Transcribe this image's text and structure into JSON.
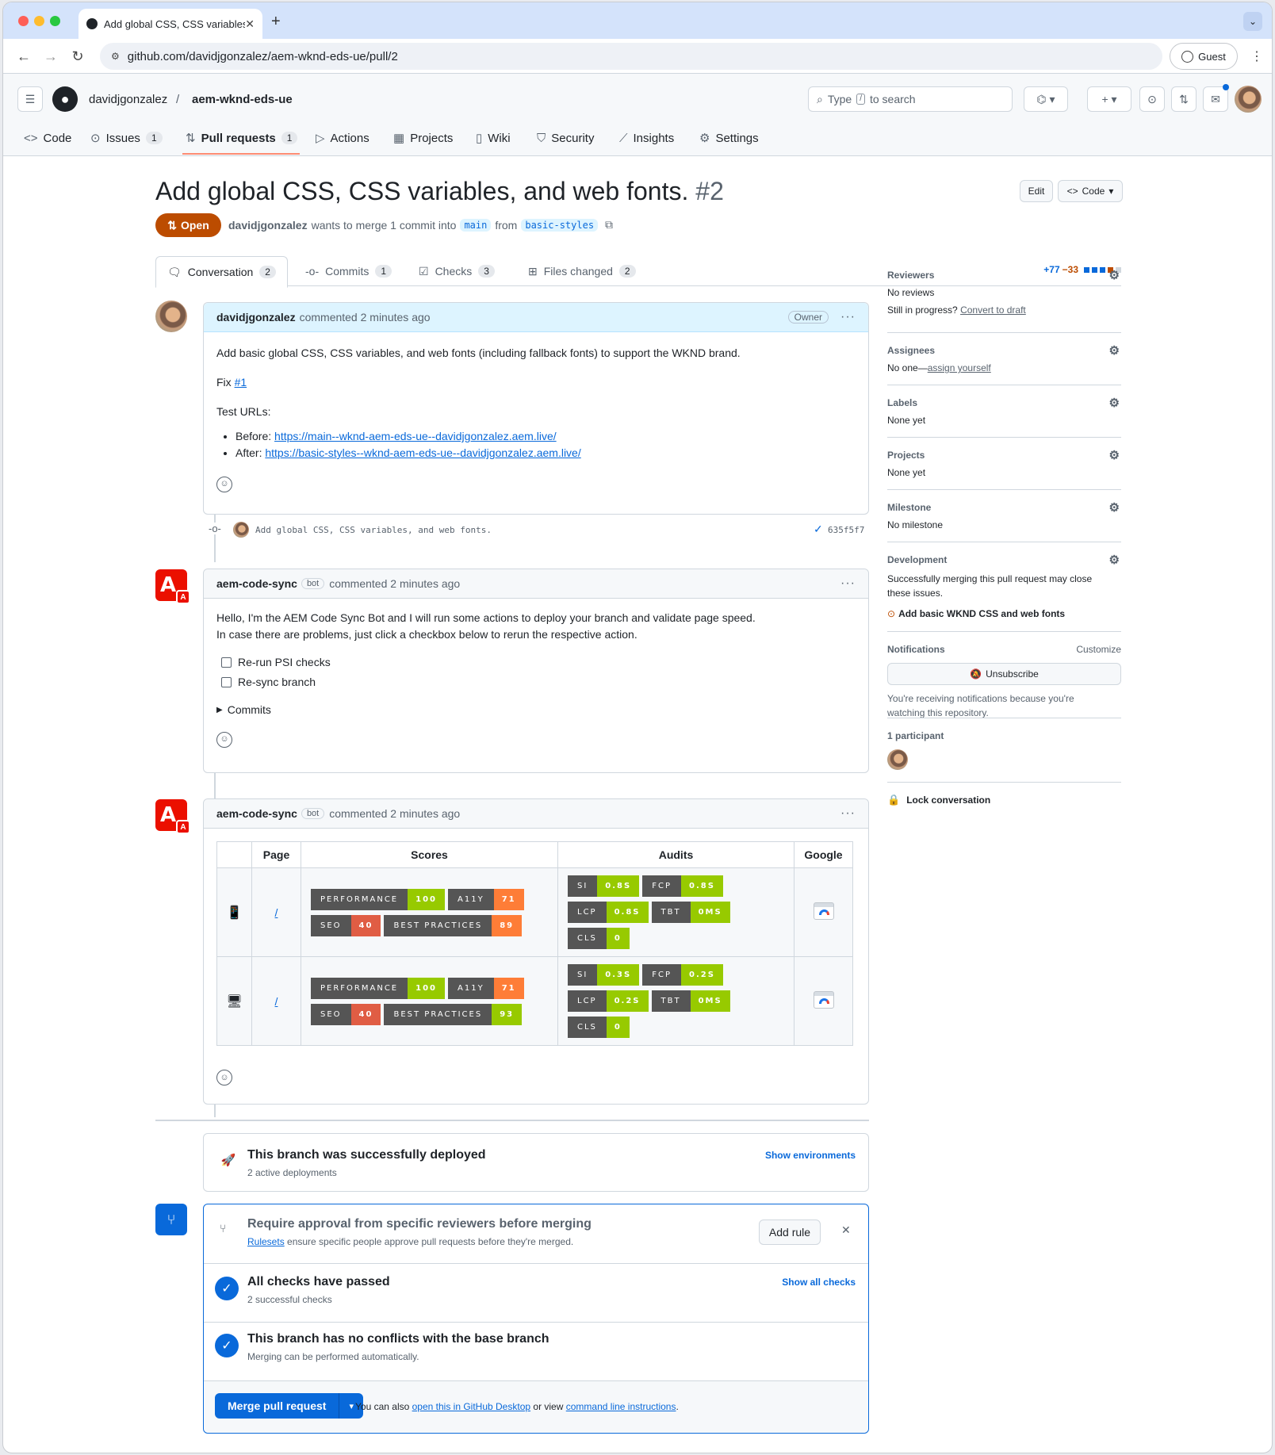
{
  "browser": {
    "tab_title": "Add global CSS, CSS variables, and web fonts",
    "url": "github.com/davidjgonzalez/aem-wknd-eds-ue/pull/2",
    "guest_label": "Guest"
  },
  "header": {
    "owner": "davidjgonzalez",
    "repo": "aem-wknd-eds-ue",
    "search_prefix": "Type",
    "search_key": "/",
    "search_suffix": "to search"
  },
  "repo_nav": [
    {
      "label": "Code",
      "count": ""
    },
    {
      "label": "Issues",
      "count": "1"
    },
    {
      "label": "Pull requests",
      "count": "1"
    },
    {
      "label": "Actions",
      "count": ""
    },
    {
      "label": "Projects",
      "count": ""
    },
    {
      "label": "Wiki",
      "count": ""
    },
    {
      "label": "Security",
      "count": ""
    },
    {
      "label": "Insights",
      "count": ""
    },
    {
      "label": "Settings",
      "count": ""
    }
  ],
  "pr": {
    "title": "Add global CSS, CSS variables, and web fonts.",
    "number": "#2",
    "state": "Open",
    "author": "davidjgonzalez",
    "meta_text": "wants to merge 1 commit into",
    "base": "main",
    "from_text": "from",
    "head": "basic-styles",
    "edit_label": "Edit",
    "code_label": "Code"
  },
  "tabs": [
    {
      "label": "Conversation",
      "count": "2"
    },
    {
      "label": "Commits",
      "count": "1"
    },
    {
      "label": "Checks",
      "count": "3"
    },
    {
      "label": "Files changed",
      "count": "2"
    }
  ],
  "diffstat": {
    "additions": "+77",
    "deletions": "−33"
  },
  "comment1": {
    "author": "davidjgonzalez",
    "action": "commented 2 minutes ago",
    "role": "Owner",
    "body_line1": "Add basic global CSS, CSS variables, and web fonts (including fallback fonts) to support the WKND brand.",
    "fix_text": "Fix",
    "fix_link": "#1",
    "test_urls": "Test URLs:",
    "before_label": "Before:",
    "before_url": "https://main--wknd-aem-eds-ue--davidjgonzalez.aem.live/",
    "after_label": "After:",
    "after_url": "https://basic-styles--wknd-aem-eds-ue--davidjgonzalez.aem.live/"
  },
  "commit": {
    "message": "Add global CSS, CSS variables, and web fonts.",
    "sha": "635f5f7"
  },
  "comment2": {
    "author": "aem-code-sync",
    "bot": "bot",
    "action": "commented 2 minutes ago",
    "line1": "Hello, I'm the AEM Code Sync Bot and I will run some actions to deploy your branch and validate page speed.",
    "line2": "In case there are problems, just click a checkbox below to rerun the respective action.",
    "check1": "Re-run PSI checks",
    "check2": "Re-sync branch",
    "commits_summary": "Commits"
  },
  "comment3": {
    "author": "aem-code-sync",
    "bot": "bot",
    "action": "commented 2 minutes ago",
    "headers": [
      "",
      "Page",
      "Scores",
      "Audits",
      "Google"
    ],
    "rows": [
      {
        "device": "📱",
        "page": "/",
        "scores": [
          [
            "PERFORMANCE",
            "100",
            "g"
          ],
          [
            "A11Y",
            "71",
            "o"
          ],
          [
            "SEO",
            "40",
            "r"
          ],
          [
            "BEST PRACTICES",
            "89",
            "o"
          ]
        ],
        "audits": [
          [
            "SI",
            "0.8S",
            "g"
          ],
          [
            "FCP",
            "0.8S",
            "g"
          ],
          [
            "LCP",
            "0.8S",
            "g"
          ],
          [
            "TBT",
            "0MS",
            "g"
          ],
          [
            "CLS",
            "0",
            "g"
          ]
        ]
      },
      {
        "device": "🖥",
        "page": "/",
        "scores": [
          [
            "PERFORMANCE",
            "100",
            "g"
          ],
          [
            "A11Y",
            "71",
            "o"
          ],
          [
            "SEO",
            "40",
            "r"
          ],
          [
            "BEST PRACTICES",
            "93",
            "g"
          ]
        ],
        "audits": [
          [
            "SI",
            "0.3S",
            "g"
          ],
          [
            "FCP",
            "0.2S",
            "g"
          ],
          [
            "LCP",
            "0.2S",
            "g"
          ],
          [
            "TBT",
            "0MS",
            "g"
          ],
          [
            "CLS",
            "0",
            "g"
          ]
        ]
      }
    ]
  },
  "deploy": {
    "title": "This branch was successfully deployed",
    "sub": "2 active deployments",
    "link": "Show environments"
  },
  "merge": {
    "rule_title": "Require approval from specific reviewers before merging",
    "rule_link": "Rulesets",
    "rule_sub": "ensure specific people approve pull requests before they're merged.",
    "add_rule": "Add rule",
    "checks_title": "All checks have passed",
    "checks_sub": "2 successful checks",
    "checks_link": "Show all checks",
    "conflicts_title": "This branch has no conflicts with the base branch",
    "conflicts_sub": "Merging can be performed automatically.",
    "merge_btn": "Merge pull request",
    "also_text": "You can also",
    "desktop_link": "open this in GitHub Desktop",
    "or_view": "or view",
    "cli_link": "command line instructions",
    "period": "."
  },
  "sidebar": {
    "reviewers": {
      "title": "Reviewers",
      "value": "No reviews",
      "draft_q": "Still in progress?",
      "draft_link": "Convert to draft"
    },
    "assignees": {
      "title": "Assignees",
      "value": "No one—",
      "link": "assign yourself"
    },
    "labels": {
      "title": "Labels",
      "value": "None yet"
    },
    "projects": {
      "title": "Projects",
      "value": "None yet"
    },
    "milestone": {
      "title": "Milestone",
      "value": "No milestone"
    },
    "development": {
      "title": "Development",
      "value": "Successfully merging this pull request may close these issues.",
      "issue": "Add basic WKND CSS and web fonts"
    },
    "notifications": {
      "title": "Notifications",
      "customize": "Customize",
      "button": "Unsubscribe",
      "note": "You're receiving notifications because you're watching this repository."
    },
    "participants": {
      "title": "1 participant"
    },
    "lock": "Lock conversation"
  }
}
